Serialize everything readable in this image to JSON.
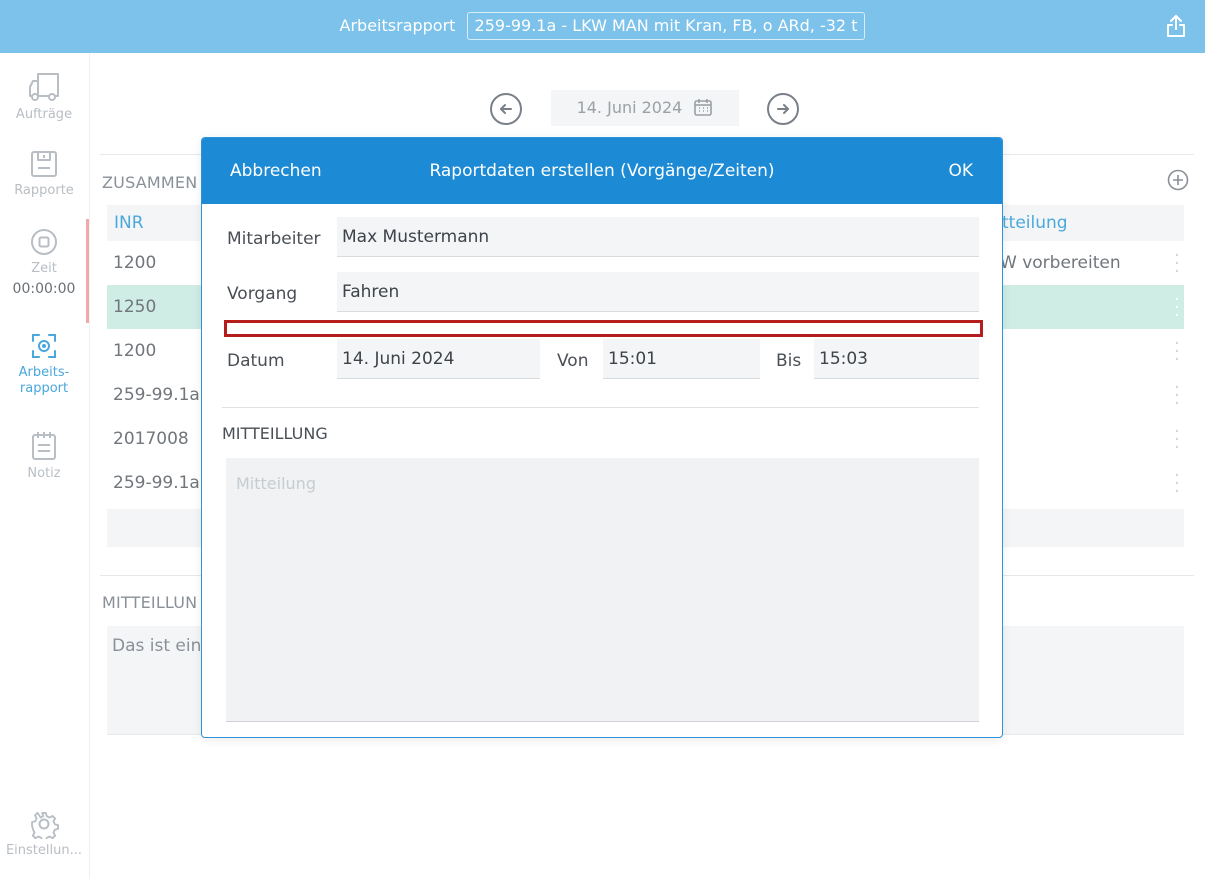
{
  "topbar": {
    "label": "Arbeitsrapport",
    "order": "259-99.1a - LKW MAN mit Kran, FB, o ARd, -32 t",
    "share_icon": "share-icon"
  },
  "sidebar": {
    "items": [
      {
        "label": "Aufträge",
        "icon": "truck-icon"
      },
      {
        "label": "Rapporte",
        "icon": "save-icon"
      },
      {
        "label": "Zeit",
        "sub": "00:00:00",
        "icon": "stop-icon"
      },
      {
        "label": "Arbeits-",
        "sub": "rapport",
        "icon": "target-icon"
      },
      {
        "label": "Notiz",
        "icon": "notepad-icon"
      },
      {
        "label": "Einstellun...",
        "icon": "gear-icon"
      }
    ]
  },
  "background": {
    "date": "14. Juni 2024",
    "summary_label": "ZUSAMMEN",
    "columns": {
      "inr": "INR",
      "message": "tteilung"
    },
    "rows": [
      {
        "inr": "1200",
        "message": "W vorbereiten"
      },
      {
        "inr": "1250",
        "message": ""
      },
      {
        "inr": "1200",
        "message": ""
      },
      {
        "inr": "259-99.1a",
        "message": ""
      },
      {
        "inr": "2017008",
        "message": ""
      },
      {
        "inr": "259-99.1a",
        "message": ""
      }
    ],
    "message_label": "MITTEILLUN",
    "message_text": "Das ist eine"
  },
  "modal": {
    "cancel": "Abbrechen",
    "title": "Raportdaten erstellen (Vorgänge/Zeiten)",
    "ok": "OK",
    "employee_label": "Mitarbeiter",
    "employee_value": "Max Mustermann",
    "process_label": "Vorgang",
    "process_value": "Fahren",
    "date_label": "Datum",
    "date_value": "14. Juni 2024",
    "from_label": "Von",
    "from_value": "15:01",
    "to_label": "Bis",
    "to_value": "15:03",
    "message_section": "MITTEILLUNG",
    "message_placeholder": "Mitteilung"
  }
}
